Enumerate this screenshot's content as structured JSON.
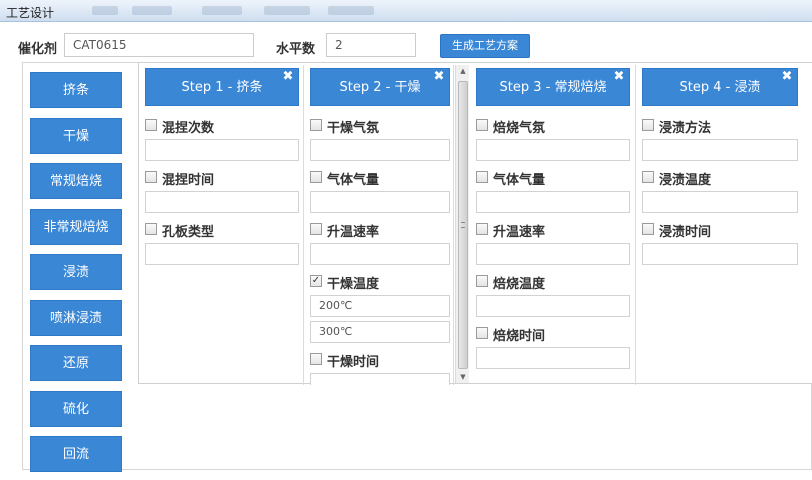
{
  "window": {
    "title": "工艺设计"
  },
  "header": {
    "catalyst_label": "催化剂",
    "catalyst_value": "CAT0615",
    "levels_label": "水平数",
    "levels_value": "2",
    "generate_button": "生成工艺方案"
  },
  "step_menu": [
    "挤条",
    "干燥",
    "常规焙烧",
    "非常规焙烧",
    "浸渍",
    "喷淋浸渍",
    "还原",
    "硫化",
    "回流"
  ],
  "steps": [
    {
      "title": "Step 1 - 挤条",
      "params": [
        {
          "label": "混捏次数",
          "checked": false,
          "values": [
            ""
          ]
        },
        {
          "label": "混捏时间",
          "checked": false,
          "values": [
            ""
          ]
        },
        {
          "label": "孔板类型",
          "checked": false,
          "values": [
            ""
          ]
        }
      ]
    },
    {
      "title": "Step 2 - 干燥",
      "params": [
        {
          "label": "干燥气氛",
          "checked": false,
          "values": [
            ""
          ]
        },
        {
          "label": "气体气量",
          "checked": false,
          "values": [
            ""
          ]
        },
        {
          "label": "升温速率",
          "checked": false,
          "values": [
            ""
          ]
        },
        {
          "label": "干燥温度",
          "checked": true,
          "values": [
            "200℃",
            "300℃"
          ]
        },
        {
          "label": "干燥时间",
          "checked": false,
          "values": [
            ""
          ]
        }
      ]
    },
    {
      "title": "Step 3 - 常规焙烧",
      "params": [
        {
          "label": "焙烧气氛",
          "checked": false,
          "values": [
            ""
          ]
        },
        {
          "label": "气体气量",
          "checked": false,
          "values": [
            ""
          ]
        },
        {
          "label": "升温速率",
          "checked": false,
          "values": [
            ""
          ]
        },
        {
          "label": "焙烧温度",
          "checked": false,
          "values": [
            ""
          ]
        },
        {
          "label": "焙烧时间",
          "checked": false,
          "values": [
            ""
          ]
        }
      ]
    },
    {
      "title": "Step 4 - 浸渍",
      "params": [
        {
          "label": "浸渍方法",
          "checked": false,
          "values": [
            ""
          ]
        },
        {
          "label": "浸渍温度",
          "checked": false,
          "values": [
            ""
          ]
        },
        {
          "label": "浸渍时间",
          "checked": false,
          "values": [
            ""
          ]
        }
      ]
    }
  ],
  "icons": {
    "close": "close-icon",
    "check": "checkbox-icon"
  }
}
